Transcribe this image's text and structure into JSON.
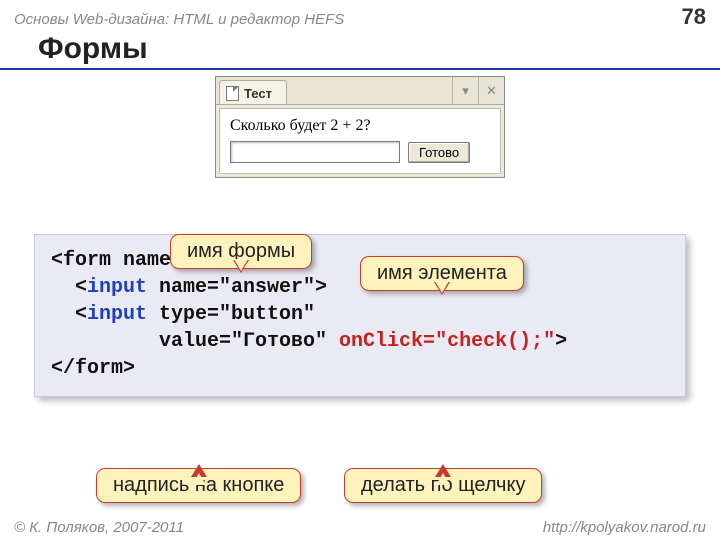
{
  "header": {
    "course": "Основы Web-дизайна: HTML и редактор HEFS",
    "page": "78"
  },
  "title": "Формы",
  "window": {
    "tab": "Тест",
    "question": "Сколько будет 2 + 2?",
    "button": "Готово"
  },
  "callouts": {
    "form_name": "имя формы",
    "element_name": "имя элемента",
    "button_label": "надпись на кнопке",
    "onclick_action": "делать по щелчку"
  },
  "code": {
    "l1a": "<form name=\"calc\">",
    "l2a": "  <",
    "l2b": "input",
    "l2c": " name=\"answer\">",
    "l3a": "  <",
    "l3b": "input",
    "l3c": " type=\"button\"",
    "l4a": "         value=\"Готово\" ",
    "l4b": "onClick=\"check();\"",
    "l4c": ">",
    "l5a": "</form>"
  },
  "footer": {
    "copyright": "© К. Поляков, 2007-2011",
    "url": "http://kpolyakov.narod.ru"
  }
}
